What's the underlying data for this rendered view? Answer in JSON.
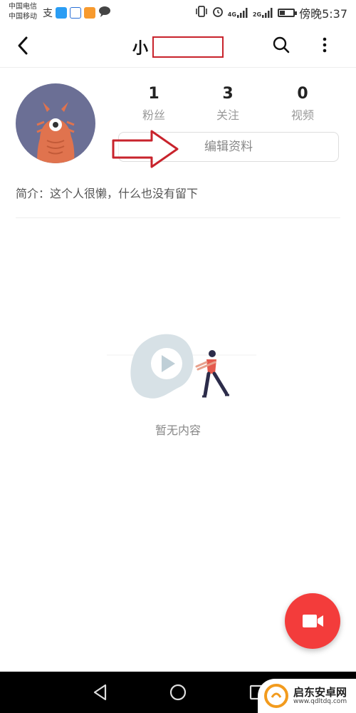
{
  "status_bar": {
    "carrier_1": "中国电信",
    "carrier_2": "中国移动",
    "network_1": "4G",
    "network_2": "2G",
    "time": "傍晚5:37",
    "battery_level": 0.4
  },
  "header": {
    "back_icon": "chevron-left-icon",
    "title": "小",
    "search_icon": "search-icon",
    "more_icon": "more-vertical-icon"
  },
  "profile": {
    "stats": [
      {
        "value": "1",
        "label": "粉丝"
      },
      {
        "value": "3",
        "label": "关注"
      },
      {
        "value": "0",
        "label": "视频"
      }
    ],
    "edit_label": "编辑资料",
    "bio": "简介：这个人很懒，什么也没有留下"
  },
  "empty_state": {
    "text": "暂无内容"
  },
  "fab": {
    "icon": "video-camera-icon",
    "color": "#f33c3b"
  },
  "navbar": {
    "back_icon": "nav-back-icon",
    "home_icon": "nav-home-icon",
    "recents_icon": "nav-recents-icon"
  },
  "watermark": {
    "name": "启东安卓网",
    "url": "www.qdltdq.com"
  },
  "colors": {
    "accent": "#f33c3b",
    "annotation_red": "#c8232c",
    "avatar_bg": "#6b6f95"
  }
}
